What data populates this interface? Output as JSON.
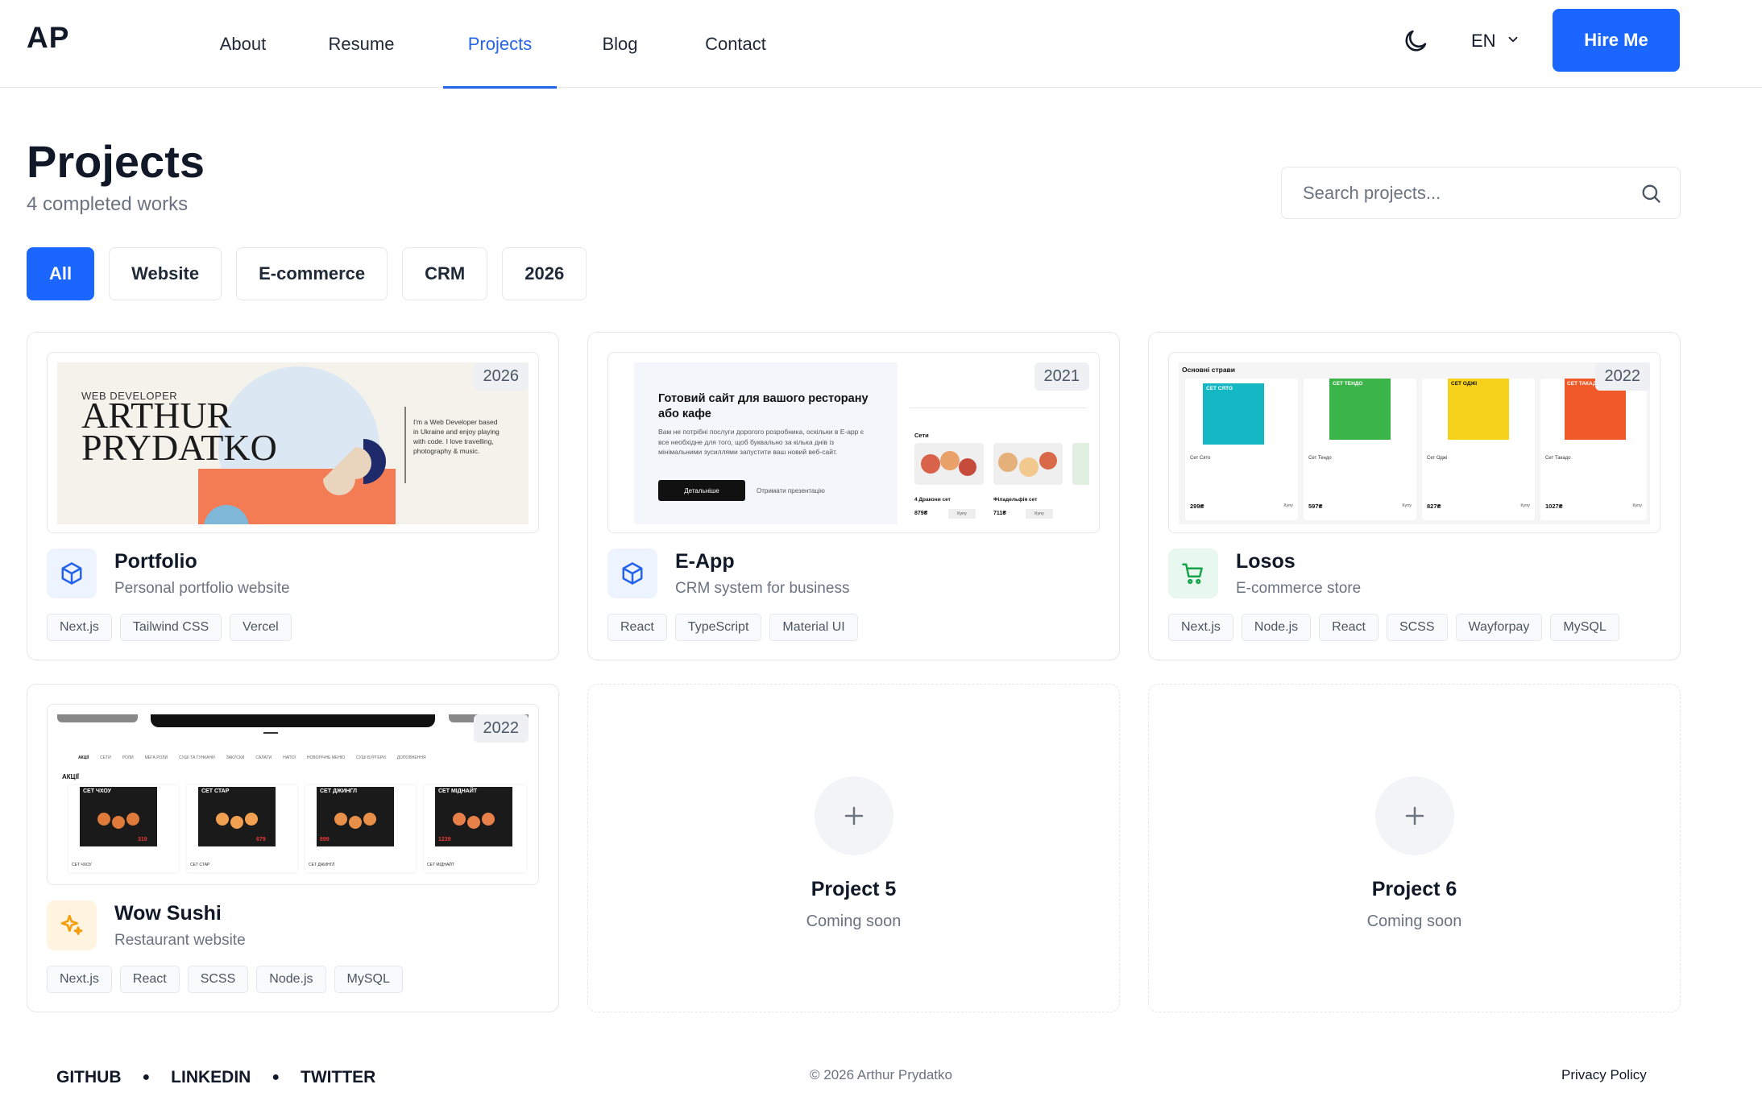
{
  "header": {
    "logo": "AP",
    "nav": [
      {
        "label": "About",
        "active": false
      },
      {
        "label": "Resume",
        "active": false
      },
      {
        "label": "Projects",
        "active": true
      },
      {
        "label": "Blog",
        "active": false
      },
      {
        "label": "Contact",
        "active": false
      }
    ],
    "theme_icon": "moon-icon",
    "language": "EN",
    "hire_label": "Hire Me"
  },
  "page": {
    "title": "Projects",
    "subtitle": "4 completed works"
  },
  "search": {
    "placeholder": "Search projects...",
    "value": ""
  },
  "filters": [
    {
      "label": "All",
      "active": true
    },
    {
      "label": "Website",
      "active": false
    },
    {
      "label": "E-commerce",
      "active": false
    },
    {
      "label": "CRM",
      "active": false
    },
    {
      "label": "2026",
      "active": false
    }
  ],
  "projects": [
    {
      "title": "Portfolio",
      "description": "Personal portfolio website",
      "year": "2026",
      "icon": "cube-icon",
      "icon_color": "#2563eb",
      "icon_bg": "#eef4ff",
      "tags": [
        "Next.js",
        "Tailwind CSS",
        "Vercel"
      ],
      "preview": {
        "kicker": "WEB DEVELOPER",
        "name_line1": "ARTHUR",
        "name_line2": "PRYDATKO",
        "bio": "I'm a Web Developer based in Ukraine and enjoy playing with code. I love travelling, photography & music."
      }
    },
    {
      "title": "E-App",
      "description": "CRM system for business",
      "year": "2021",
      "icon": "cube-icon",
      "icon_color": "#2563eb",
      "icon_bg": "#eef4ff",
      "tags": [
        "React",
        "TypeScript",
        "Material UI"
      ],
      "preview": {
        "headline": "Готовий сайт для вашого ресторану або кафе",
        "body": "Вам не потрібні послуги дорогого розробника, оскільки в E-app є все необхідне для того, щоб буквально за кілька днів із мінімальними зусиллями запустити ваш новий веб-сайт.",
        "primary_btn": "Детальніше",
        "secondary_link": "Отримати презентацію",
        "section": "Сети",
        "item1": "4 Дракони сет",
        "item2": "Філадельфія сет",
        "price1": "879₴",
        "price2": "711₴",
        "buy": "Купу"
      }
    },
    {
      "title": "Losos",
      "description": "E-commerce store",
      "year": "2022",
      "icon": "cart-icon",
      "icon_color": "#16a34a",
      "icon_bg": "#e8f8ee",
      "tags": [
        "Next.js",
        "Node.js",
        "React",
        "SCSS",
        "Wayforpay",
        "MySQL"
      ],
      "preview": {
        "section": "Основні страви",
        "items": [
          {
            "label": "СЕТ СЯТО",
            "name": "Сет Сято",
            "price": "299₴",
            "color": "#14b8c4"
          },
          {
            "label": "СЕТ ТЕНДО",
            "name": "Сет Тендо",
            "price": "597₴",
            "color": "#3bb54a"
          },
          {
            "label": "СЕТ ОДЖІ",
            "name": "Сет Оджі",
            "price": "827₴",
            "color": "#f7d21b"
          },
          {
            "label": "СЕТ ТАКАДО",
            "name": "Сет Такадо",
            "price": "1027₴",
            "color": "#f05a28"
          }
        ],
        "buy": "Купу"
      }
    },
    {
      "title": "Wow Sushi",
      "description": "Restaurant website",
      "year": "2022",
      "icon": "sparkles-icon",
      "icon_color": "#f59e0b",
      "icon_bg": "#fff4e0",
      "tags": [
        "Next.js",
        "React",
        "SCSS",
        "Node.js",
        "MySQL"
      ],
      "preview": {
        "menu": [
          "АКЦІЇ",
          "СЕТИ",
          "РОЛИ",
          "МЕГА РОЛИ",
          "СУШІ ТА ГУНКАНИ",
          "ЗАКУСКИ",
          "САЛАТИ",
          "НАПОЇ",
          "НОВОРІЧНЕ МЕНЮ",
          "СУШІ БУРГЕРИ",
          "ДОПОВНЕННЯ"
        ],
        "section": "АКЦІЇ",
        "items": [
          {
            "label": "СЕТ ЧХОУ",
            "name": "СЕТ ЧХОУ",
            "price": "319"
          },
          {
            "label": "СЕТ СТАР",
            "name": "СЕТ СТАР",
            "price": "679"
          },
          {
            "label": "СЕТ ДЖИНГЛ",
            "name": "СЕТ ДЖИНГЛ",
            "price": "899"
          },
          {
            "label": "СЕТ МІДНАЙТ",
            "name": "СЕТ МІДНАЙТ",
            "price": "1239"
          }
        ]
      }
    }
  ],
  "placeholders": [
    {
      "title": "Project 5",
      "subtitle": "Coming soon",
      "icon": "plus-icon"
    },
    {
      "title": "Project 6",
      "subtitle": "Coming soon",
      "icon": "plus-icon"
    }
  ],
  "footer": {
    "social": [
      "GITHUB",
      "LINKEDIN",
      "TWITTER"
    ],
    "copyright": "© 2026 Arthur Prydatko",
    "privacy": "Privacy Policy"
  },
  "colors": {
    "accent": "#1a66ff",
    "border": "#e5e7eb",
    "muted_text": "#6b7280"
  }
}
